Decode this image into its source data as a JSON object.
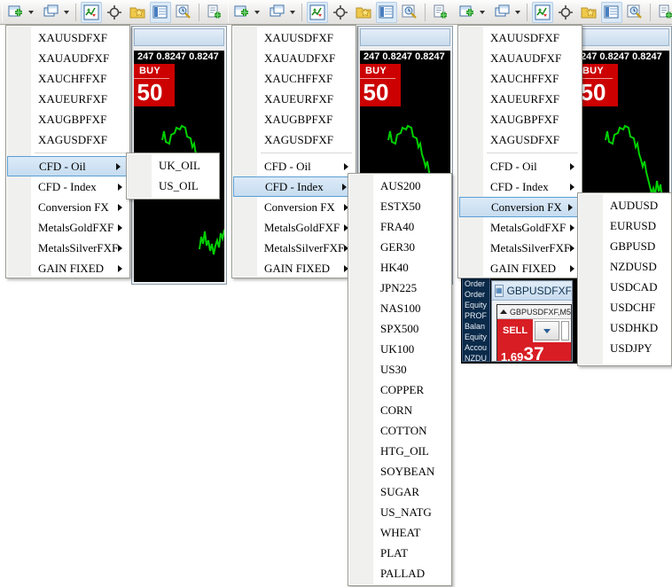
{
  "toolbar": {
    "icons": [
      {
        "name": "new-chart-icon",
        "glyph": "＋"
      },
      {
        "name": "chevron-down-icon",
        "glyph": "▾"
      },
      {
        "name": "tile-windows-icon",
        "glyph": "▤"
      },
      {
        "name": "chevron-down-icon-2",
        "glyph": "▾"
      },
      {
        "name": "indicators-icon",
        "glyph": "◈"
      },
      {
        "name": "crosshair-icon",
        "glyph": "✛"
      },
      {
        "name": "favorites-folder-icon",
        "glyph": "★"
      },
      {
        "name": "market-watch-icon",
        "glyph": "▥"
      },
      {
        "name": "zoom-history-icon",
        "glyph": "⌕"
      },
      {
        "name": "new-order-icon",
        "glyph": "▤"
      }
    ]
  },
  "chart": {
    "quote": "247 0.8247 0.8247",
    "buy_label": "BUY",
    "buy_price": "50"
  },
  "menu": {
    "symbols": [
      "XAUUSDFXF",
      "XAUAUDFXF",
      "XAUCHFFXF",
      "XAUEURFXF",
      "XAUGBPFXF",
      "XAGUSDFXF"
    ],
    "groups": [
      "CFD - Oil",
      "CFD - Index",
      "Conversion FX",
      "MetalsGoldFXF",
      "MetalsSilverFXF",
      "GAIN FIXED"
    ],
    "selected": {
      "panel1": "CFD - Oil",
      "panel2": "CFD - Index",
      "panel3": "Conversion FX"
    }
  },
  "submenus": {
    "cfd_oil": [
      "UK_OIL",
      "US_OIL"
    ],
    "cfd_index": [
      "AUS200",
      "ESTX50",
      "FRA40",
      "GER30",
      "HK40",
      "JPN225",
      "NAS100",
      "SPX500",
      "UK100",
      "US30",
      "COPPER",
      "CORN",
      "COTTON",
      "HTG_OIL",
      "SOYBEAN",
      "SUGAR",
      "US_NATG",
      "WHEAT",
      "PLAT",
      "PALLAD"
    ],
    "conversion_fx": [
      "AUDUSD",
      "EURUSD",
      "GBPUSD",
      "NZDUSD",
      "USDCAD",
      "USDCHF",
      "USDHKD",
      "USDJPY"
    ]
  },
  "terminal": {
    "rows": [
      "Order",
      "Order",
      "Equity",
      "PROF",
      "Balan",
      "Equity",
      "Accou",
      "NZDU"
    ]
  },
  "miniwindow": {
    "title": "GBPUSDFXF,",
    "chart_label": "GBPUSDFXF,M5",
    "sell_label": "SELL",
    "price_small": "1.69",
    "price_big": "37"
  },
  "colors": {
    "accent_blue": "#5a9fd4",
    "highlight": "#cde2f5",
    "buy_red": "#cc0000",
    "sell_red": "#d81d24",
    "chart_line_green": "#00d000",
    "chart_bg": "#000000"
  }
}
